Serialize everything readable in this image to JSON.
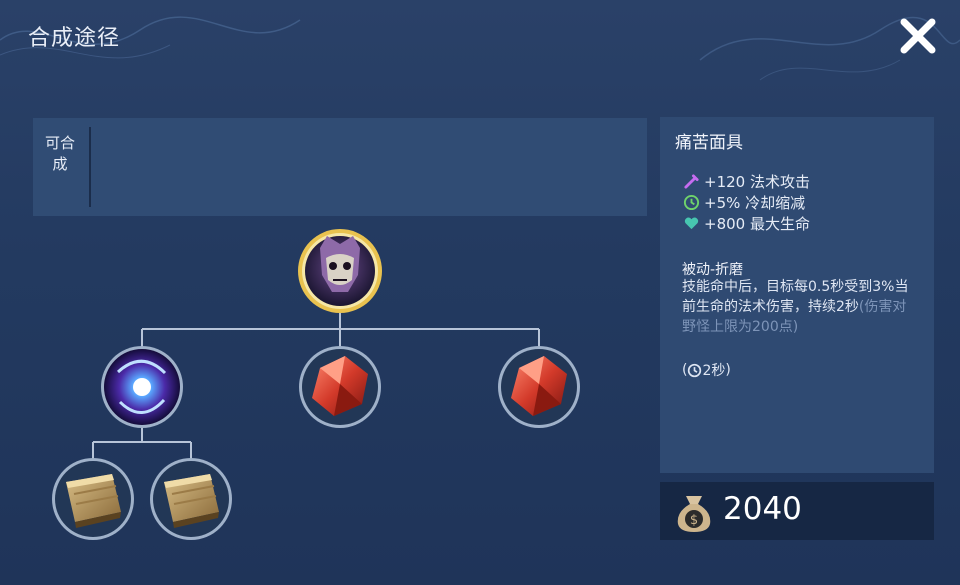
{
  "title": "合成途径",
  "craftable_label": "可合成",
  "item": {
    "name": "痛苦面具",
    "stats": [
      {
        "icon": "magic-attack-icon",
        "text": "+120 法术攻击",
        "color": "#c56cf0"
      },
      {
        "icon": "cooldown-icon",
        "text": "+5% 冷却缩减",
        "color": "#6fd36b"
      },
      {
        "icon": "heart-icon",
        "text": "+800 最大生命",
        "color": "#47c6b0"
      }
    ],
    "passive_title": "被动-折磨",
    "passive_desc": "技能命中后，目标每0.5秒受到3%当前生命的法术伤害，持续2秒",
    "passive_note": "(伤害对野怪上限为200点)",
    "cooldown": "2秒",
    "price": "2040"
  },
  "recipe": {
    "root": {
      "icon": "mask-of-agony-icon"
    },
    "children": [
      {
        "icon": "arcane-orb-icon",
        "children": [
          {
            "icon": "wooden-tome-icon"
          },
          {
            "icon": "wooden-tome-icon"
          }
        ]
      },
      {
        "icon": "red-crystal-icon"
      },
      {
        "icon": "red-crystal-icon"
      }
    ]
  }
}
